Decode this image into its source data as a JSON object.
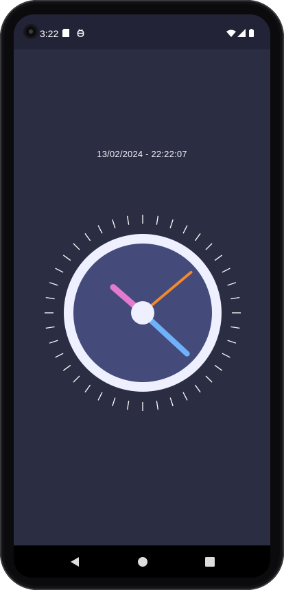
{
  "status_bar": {
    "time": "3:22",
    "icons": [
      "camera-icon",
      "sd-card-icon",
      "debug-icon",
      "wifi-icon",
      "signal-icon",
      "battery-icon"
    ]
  },
  "clock": {
    "datetime_label": "13/02/2024 - 22:22:07",
    "hours": 22,
    "minutes": 22,
    "seconds": 7,
    "colors": {
      "background": "#2b2d43",
      "ring": "#eef0ff",
      "face": "#444b7a",
      "hour_hand": "#e47ad0",
      "minute_hand": "#6fb1fb",
      "second_hand": "#f28a2c",
      "tick": "#ffffff"
    }
  },
  "nav_bar": {
    "buttons": [
      "back-icon",
      "home-icon",
      "recents-icon"
    ]
  }
}
